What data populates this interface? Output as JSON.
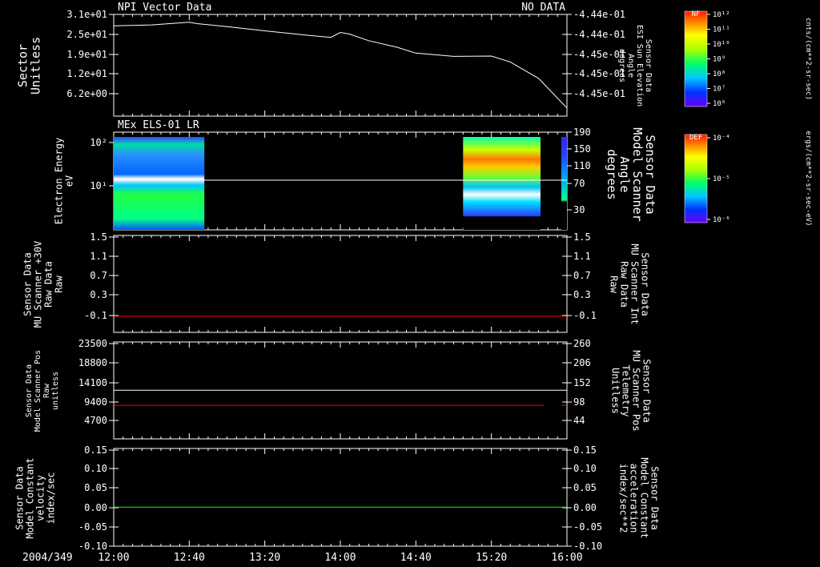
{
  "footer": {
    "date": "2004/349"
  },
  "time_axis": {
    "ticks": [
      "12:00",
      "12:40",
      "13:20",
      "14:00",
      "14:40",
      "15:20",
      "16:00"
    ]
  },
  "colors": {
    "background": "#000000",
    "foreground": "#ffffff",
    "red_series": "#ff0000",
    "green_series": "#00ff00"
  },
  "panels": [
    {
      "title_left": "NPI Vector Data",
      "title_right": "NO DATA",
      "left_label": [
        "Sector",
        "Unitless"
      ],
      "left_ticks": [
        "3.1e+01",
        "2.5e+01",
        "1.9e+01",
        "1.2e+01",
        "6.2e+00"
      ],
      "right_label": [
        "Sensor Data",
        "ESI Sun Elevation",
        "Angle",
        "degrees"
      ],
      "right_ticks": [
        "-4.44e-01",
        "-4.44e-01",
        "-4.45e-01",
        "-4.45e-01",
        "-4.45e-01"
      ],
      "colorbar": {
        "title": "NF",
        "unit": "cnts/(cm**2-sr-sec)",
        "ticks": [
          "10¹²",
          "10¹¹",
          "10¹⁰",
          "10⁹",
          "10⁸",
          "10⁷",
          "10⁶"
        ]
      }
    },
    {
      "title_left": "MEx ELS-01 LR",
      "left_label": [
        "Electron Energy",
        "eV"
      ],
      "left_ticks": [
        "10²",
        "10¹"
      ],
      "right_label": [
        "Sensor Data",
        "Model Scanner",
        "Angle",
        "degrees"
      ],
      "right_ticks": [
        "190",
        "150",
        "110",
        "70",
        "30"
      ],
      "colorbar": {
        "title": "DEF",
        "unit": "ergs/(cm**2-sr-sec-eV)",
        "ticks": [
          "10⁻⁴",
          "10⁻⁵",
          "10⁻⁶"
        ]
      }
    },
    {
      "left_label": [
        "Sensor Data",
        "MU Scanner +30V",
        "Raw Data",
        "Raw"
      ],
      "left_ticks": [
        "1.5",
        "1.1",
        "0.7",
        "0.3",
        "-0.1"
      ],
      "right_label": [
        "Sensor Data",
        "MU Scanner Int",
        "Raw Data",
        "Raw"
      ],
      "right_ticks": [
        "1.5",
        "1.1",
        "0.7",
        "0.3",
        "-0.1"
      ]
    },
    {
      "left_label": [
        "Sensor Data",
        "Model Scanner Pos",
        "Raw",
        "unitless"
      ],
      "left_ticks": [
        "23500",
        "18800",
        "14100",
        "9400",
        "4700"
      ],
      "right_label": [
        "Sensor Data",
        "MU Scanner Pos",
        "Telemetry",
        "Unitless"
      ],
      "right_ticks": [
        "260",
        "206",
        "152",
        "98",
        "44"
      ]
    },
    {
      "left_label": [
        "Sensor Data",
        "Model Constant",
        "velocity",
        "index/sec"
      ],
      "left_ticks": [
        "0.15",
        "0.10",
        "0.05",
        "0.00",
        "-0.05",
        "-0.10"
      ],
      "right_label": [
        "Sensor Data",
        "Model Constant",
        "acceleration",
        "index/sec**2"
      ],
      "right_ticks": [
        "0.15",
        "0.10",
        "0.05",
        "0.00",
        "-0.05",
        "-0.10"
      ]
    }
  ],
  "chart_data": [
    {
      "type": "line",
      "title": "NPI Vector Data",
      "ylabel": "Sector Unitless",
      "y2label": "Sensor Data ESI Sun Elevation Angle degrees",
      "x_range": [
        "12:00",
        "16:00"
      ],
      "ylim": [
        0,
        31
      ],
      "series": [
        {
          "x": [
            "12:00",
            "12:20",
            "12:40",
            "12:44",
            "13:00",
            "13:20",
            "13:40",
            "13:55",
            "14:00",
            "14:05",
            "14:15",
            "14:30",
            "14:40",
            "15:00",
            "15:20",
            "15:30",
            "15:45",
            "15:55",
            "16:00"
          ],
          "y": [
            27.5,
            27.8,
            28.6,
            28.2,
            27.3,
            26.0,
            24.8,
            24.0,
            25.5,
            25.0,
            23.0,
            21.0,
            19.2,
            18.2,
            18.3,
            16.5,
            11.5,
            5.5,
            2.5
          ]
        }
      ]
    },
    {
      "type": "heatmap",
      "title": "MEx ELS-01 LR",
      "ylabel": "Electron Energy eV",
      "y2label": "Sensor Data Model Scanner Angle degrees",
      "x_range": [
        "12:00",
        "16:00"
      ],
      "y2lim": [
        10,
        190
      ],
      "blocks": [
        {
          "start": "12:00",
          "end": "12:48"
        },
        {
          "start": "15:05",
          "end": "15:46"
        },
        {
          "start": "15:57",
          "end": "16:00"
        }
      ],
      "series": [
        {
          "x": [
            "12:00",
            "16:00"
          ],
          "y": [
            100,
            100
          ]
        }
      ]
    },
    {
      "type": "line",
      "ylabel": "Sensor Data MU Scanner +30V Raw Data Raw",
      "y2label": "Sensor Data MU Scanner Int Raw Data Raw",
      "x_range": [
        "12:00",
        "16:00"
      ],
      "ylim": [
        -0.3,
        1.5
      ],
      "series": [
        {
          "x": [
            "12:00",
            "16:00"
          ],
          "y": [
            0.0,
            0.0
          ]
        }
      ]
    },
    {
      "type": "line",
      "ylabel": "Sensor Data Model Scanner Pos Raw unitless",
      "y2label": "Sensor Data MU Scanner Pos Telemetry Unitless",
      "x_range": [
        "12:00",
        "16:00"
      ],
      "ylim": [
        0,
        23500
      ],
      "y2lim": [
        0,
        260
      ],
      "series": [
        {
          "x": [
            "12:00",
            "16:00"
          ],
          "y": [
            11800,
            11800
          ]
        },
        {
          "x": [
            "12:00",
            "15:48"
          ],
          "y": [
            90,
            90
          ]
        },
        {
          "x": [
            "15:57",
            "16:00"
          ],
          "y": [
            90,
            90
          ]
        }
      ]
    },
    {
      "type": "line",
      "ylabel": "Sensor Data Model Constant velocity index/sec",
      "y2label": "Sensor Data Model Constant acceleration index/sec**2",
      "x_range": [
        "12:00",
        "16:00"
      ],
      "ylim": [
        -0.1,
        0.15
      ],
      "series": [
        {
          "x": [
            "12:00",
            "16:00"
          ],
          "y": [
            0.0,
            0.0
          ]
        }
      ]
    }
  ]
}
